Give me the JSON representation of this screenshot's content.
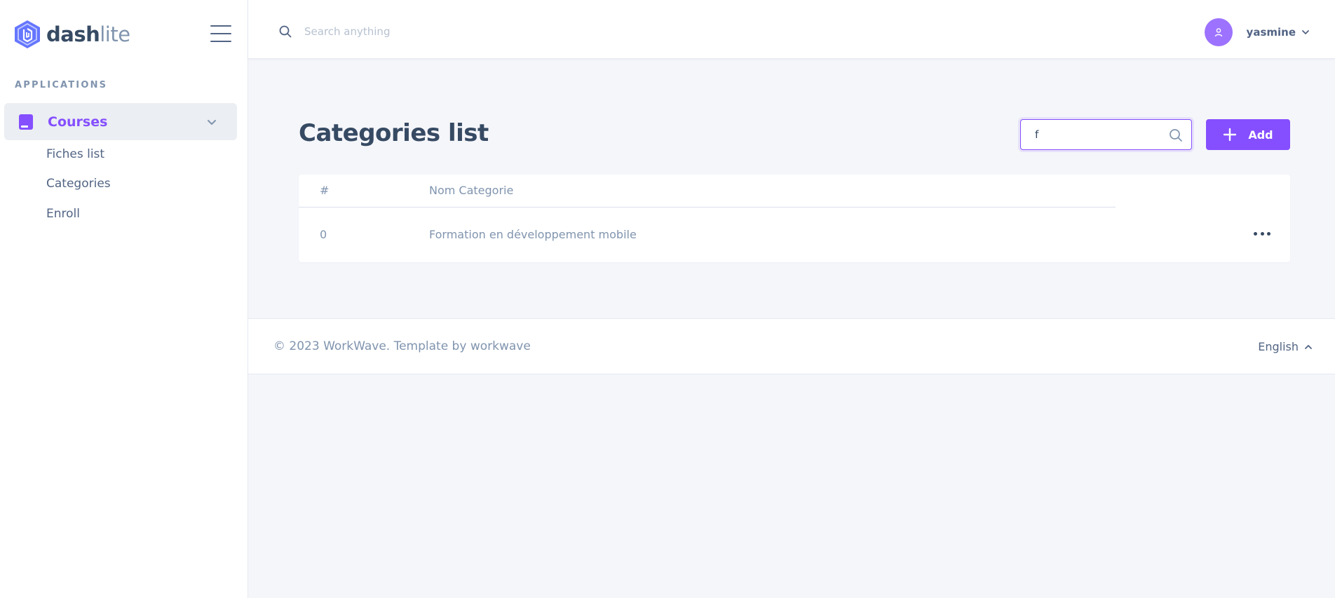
{
  "brand": {
    "name_bold": "dash",
    "name_light": "lite",
    "logo_icon": "hexagon-logo-icon"
  },
  "sidebar": {
    "heading": "APPLICATIONS",
    "main_item": {
      "label": "Courses",
      "icon": "book-icon",
      "expanded": true
    },
    "sub_items": [
      {
        "label": "Fiches list"
      },
      {
        "label": "Categories"
      },
      {
        "label": "Enroll"
      }
    ]
  },
  "header": {
    "search_placeholder": "Search anything",
    "user": {
      "name": "yasmine",
      "avatar_icon": "user-icon"
    }
  },
  "main": {
    "title": "Categories list",
    "filter_value": "f",
    "add_label": "Add",
    "table": {
      "columns": [
        "#",
        "Nom Categorie"
      ],
      "rows": [
        {
          "id": "0",
          "name": "Formation en développement mobile"
        }
      ]
    }
  },
  "footer": {
    "copyright": "© 2023 WorkWave. Template by workwave",
    "language": "English"
  },
  "colors": {
    "accent": "#854fff",
    "avatar": "#9d72ff",
    "text_dark": "#364a63",
    "text_muted": "#8094ae",
    "background": "#f5f6fa"
  }
}
